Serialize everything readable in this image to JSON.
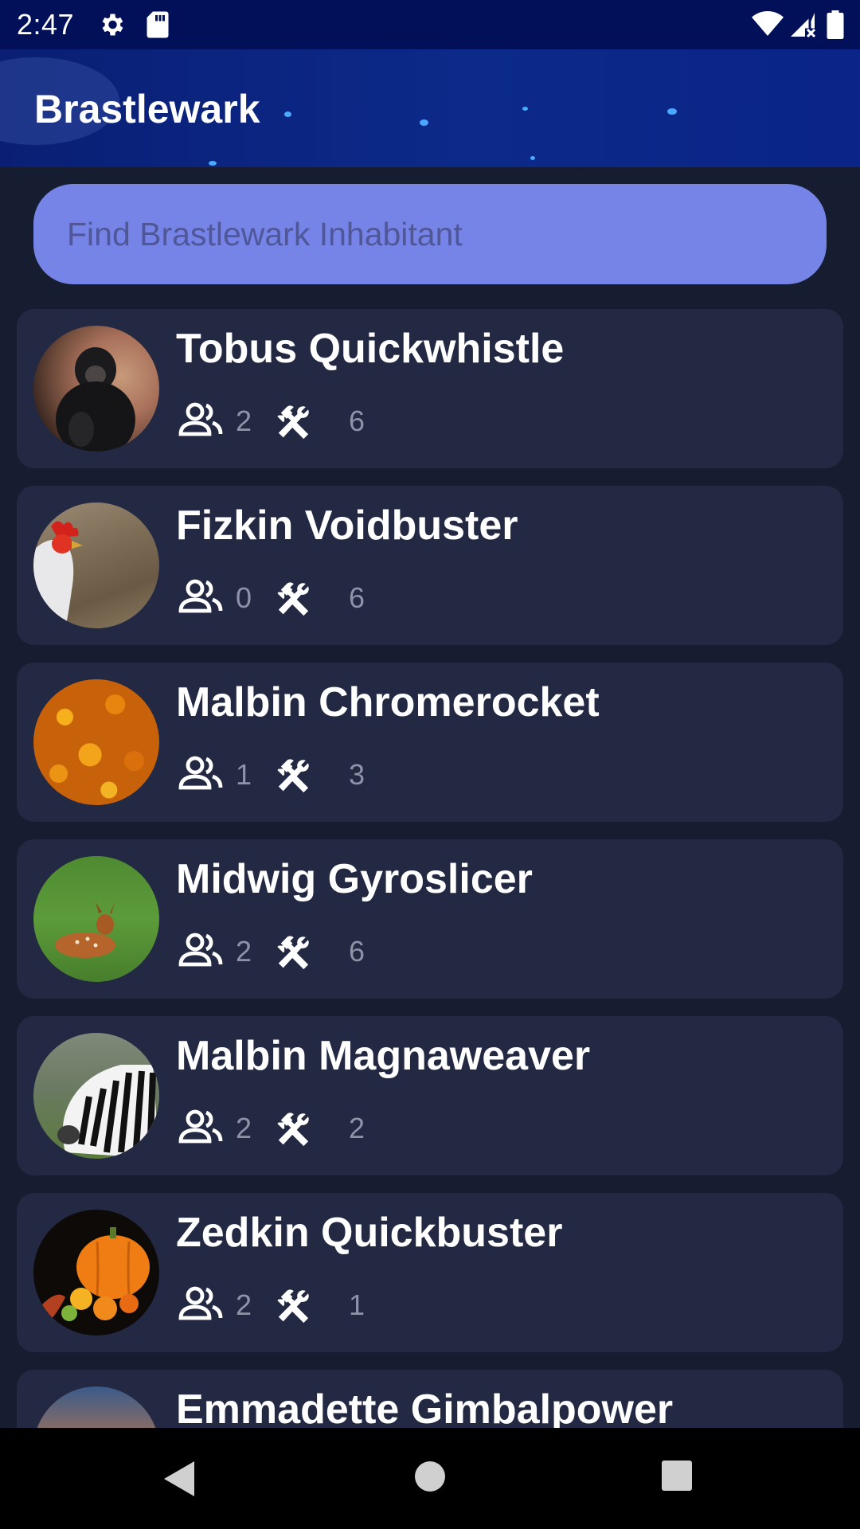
{
  "status_bar": {
    "time": "2:47",
    "icons": [
      "gear-icon",
      "sd-card-icon",
      "wifi-icon",
      "signal-icon",
      "battery-icon"
    ]
  },
  "app": {
    "title": "Brastlewark"
  },
  "search": {
    "placeholder": "Find Brastlewark Inhabitant",
    "value": ""
  },
  "inhabitants": [
    {
      "name": "Tobus Quickwhistle",
      "friends": "2",
      "professions": "6",
      "avatar": "chimpanzee"
    },
    {
      "name": "Fizkin Voidbuster",
      "friends": "0",
      "professions": "6",
      "avatar": "rooster"
    },
    {
      "name": "Malbin Chromerocket",
      "friends": "1",
      "professions": "3",
      "avatar": "autumn-leaves"
    },
    {
      "name": "Midwig Gyroslicer",
      "friends": "2",
      "professions": "6",
      "avatar": "fawn"
    },
    {
      "name": "Malbin Magnaweaver",
      "friends": "2",
      "professions": "2",
      "avatar": "zebra"
    },
    {
      "name": "Zedkin Quickbuster",
      "friends": "2",
      "professions": "1",
      "avatar": "pumpkin-harvest"
    },
    {
      "name": "Emmadette Gimbalpower",
      "avatar": "ocean"
    }
  ],
  "colors": {
    "status_bar": "#02105a",
    "header": "#0c2a8a",
    "background": "#171d30",
    "card": "#232843",
    "search_field": "#7584e6"
  },
  "nav_bar": {
    "icons": [
      "back-icon",
      "home-icon",
      "recents-icon"
    ]
  }
}
